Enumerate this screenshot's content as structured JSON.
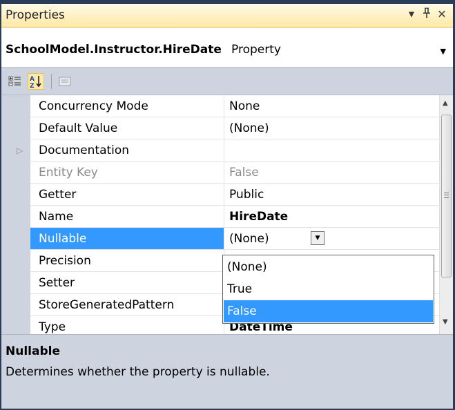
{
  "window": {
    "title": "Properties",
    "menu_glyph": "▼",
    "pin_glyph": "ᵽ",
    "close_glyph": "✕"
  },
  "object_selector": {
    "name": "SchoolModel.Instructor.HireDate",
    "type": "Property",
    "dropdown_glyph": "▼"
  },
  "toolbar": {
    "categorized_icon": "categorized-icon",
    "alphabetical_icon": "alphabetical-icon",
    "property_pages_icon": "property-pages-icon"
  },
  "properties": [
    {
      "name": "Concurrency Mode",
      "value": "None"
    },
    {
      "name": "Default Value",
      "value": "(None)"
    },
    {
      "name": "Documentation",
      "value": "",
      "expander": "▷"
    },
    {
      "name": "Entity Key",
      "value": "False"
    },
    {
      "name": "Getter",
      "value": "Public"
    },
    {
      "name": "Name",
      "value": "HireDate"
    },
    {
      "name": "Nullable",
      "value": "(None)"
    },
    {
      "name": "Precision",
      "value": ""
    },
    {
      "name": "Setter",
      "value": ""
    },
    {
      "name": "StoreGeneratedPattern",
      "value": ""
    },
    {
      "name": "Type",
      "value": "DateTime"
    }
  ],
  "dropdown": {
    "button_glyph": "▼",
    "options": [
      "(None)",
      "True",
      "False"
    ],
    "highlighted": "False"
  },
  "scrollbar": {
    "up_glyph": "▲",
    "down_glyph": "▼"
  },
  "description": {
    "title": "Nullable",
    "text": "Determines whether the property is nullable."
  },
  "colors": {
    "selection": "#3399ff",
    "title_gradient_top": "#fffbe6",
    "title_gradient_bottom": "#ffe8a6",
    "gutter": "#ced4df",
    "frame": "#2b3c59"
  }
}
